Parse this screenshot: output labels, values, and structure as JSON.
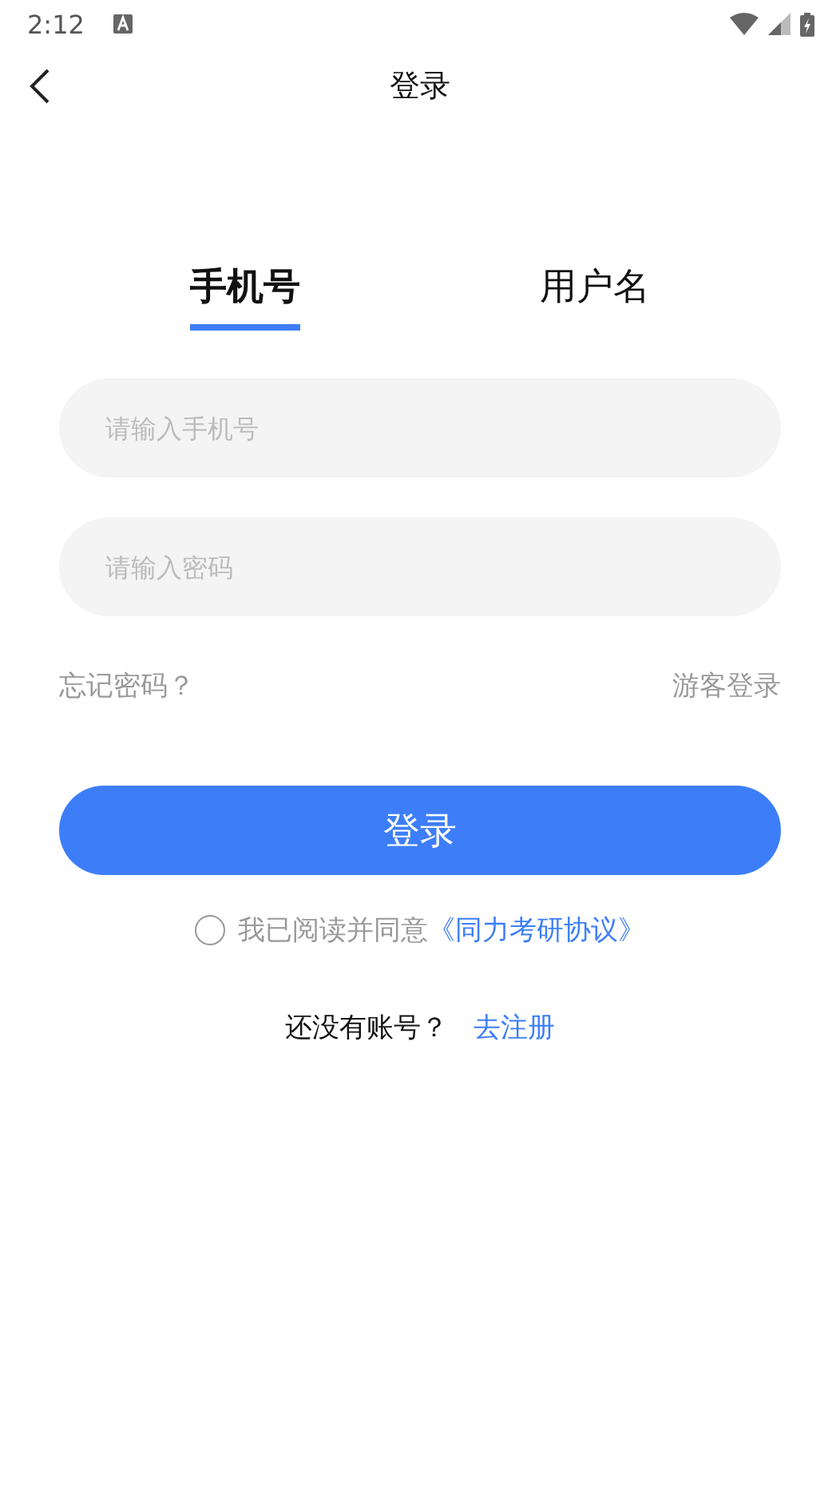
{
  "status_bar": {
    "time": "2:12"
  },
  "header": {
    "title": "登录"
  },
  "tabs": [
    {
      "label": "手机号",
      "selected": true
    },
    {
      "label": "用户名",
      "selected": false
    }
  ],
  "fields": [
    {
      "placeholder": "请输入手机号"
    },
    {
      "placeholder": "请输入密码"
    }
  ],
  "links": {
    "forgot": "忘记密码？",
    "guest": "游客登录"
  },
  "login_button": "登录",
  "agreement": {
    "checked": false,
    "text": "我已阅读并同意",
    "link": "《同力考研协议》"
  },
  "register": {
    "prompt": "还没有账号？",
    "link": "去注册"
  }
}
